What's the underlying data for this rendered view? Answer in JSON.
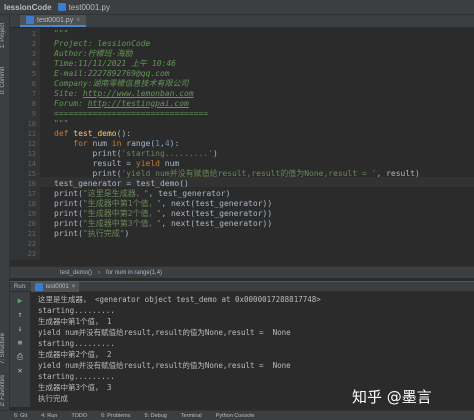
{
  "titlebar": {
    "project": "lessionCode",
    "file": "test0001.py"
  },
  "editor": {
    "tab_label": "test0001.py",
    "line_numbers": [
      "1",
      "2",
      "3",
      "4",
      "5",
      "6",
      "7",
      "8",
      "9",
      "10",
      "11",
      "12",
      "13",
      "14",
      "15",
      "16",
      "17",
      "18",
      "19",
      "20",
      "21",
      "22",
      "23"
    ],
    "lines": [
      {
        "segments": [
          {
            "text": "\"\"\"",
            "cls": "doc"
          }
        ]
      },
      {
        "segments": [
          {
            "text": "Project: lessionCode",
            "cls": "doc"
          }
        ]
      },
      {
        "segments": [
          {
            "text": "Author:柠檬班-海励",
            "cls": "doc"
          }
        ]
      },
      {
        "segments": [
          {
            "text": "Time:11/11/2021 上午 10:46",
            "cls": "doc"
          }
        ]
      },
      {
        "segments": [
          {
            "text": "E-mail:2227892769@qq.com",
            "cls": "doc"
          }
        ]
      },
      {
        "segments": [
          {
            "text": "Company:湖南零檬信息技术有限公司",
            "cls": "doc"
          }
        ]
      },
      {
        "segments": [
          {
            "text": "Site: ",
            "cls": "doc"
          },
          {
            "text": "http://www.lemonban.com",
            "cls": "doc u"
          }
        ]
      },
      {
        "segments": [
          {
            "text": "Forum: ",
            "cls": "doc"
          },
          {
            "text": "http://testingpai.com",
            "cls": "doc u"
          }
        ]
      },
      {
        "segments": [
          {
            "text": "================================",
            "cls": "doc"
          }
        ]
      },
      {
        "segments": [
          {
            "text": "\"\"\"",
            "cls": "doc"
          }
        ]
      },
      {
        "segments": [
          {
            "text": "def ",
            "cls": "kw"
          },
          {
            "text": "test_demo",
            "cls": "fn"
          },
          {
            "text": "():",
            "cls": ""
          }
        ]
      },
      {
        "segments": [
          {
            "text": "    for ",
            "cls": "kw"
          },
          {
            "text": "num ",
            "cls": ""
          },
          {
            "text": "in ",
            "cls": "kw"
          },
          {
            "text": "range(",
            "cls": ""
          },
          {
            "text": "1",
            "cls": "num"
          },
          {
            "text": ",",
            "cls": ""
          },
          {
            "text": "4",
            "cls": "num"
          },
          {
            "text": "):",
            "cls": ""
          }
        ]
      },
      {
        "segments": [
          {
            "text": "        print(",
            "cls": ""
          },
          {
            "text": "'starting.........'",
            "cls": "str"
          },
          {
            "text": ")",
            "cls": ""
          }
        ]
      },
      {
        "segments": [
          {
            "text": "        result = ",
            "cls": ""
          },
          {
            "text": "yield ",
            "cls": "kw"
          },
          {
            "text": "num",
            "cls": ""
          }
        ]
      },
      {
        "segments": [
          {
            "text": "        print(",
            "cls": ""
          },
          {
            "text": "'yield num并没有赋值给result,result的值为None,result = '",
            "cls": "str"
          },
          {
            "text": ", result)",
            "cls": ""
          }
        ]
      },
      {
        "segments": [
          {
            "text": "test_generator = test_demo()",
            "cls": ""
          }
        ]
      },
      {
        "segments": [
          {
            "text": "print(",
            "cls": ""
          },
          {
            "text": "\"这里是生成器，\"",
            "cls": "str"
          },
          {
            "text": ", test_generator)",
            "cls": ""
          }
        ]
      },
      {
        "segments": [
          {
            "text": "print(",
            "cls": ""
          },
          {
            "text": "\"生成器中第1个值，\"",
            "cls": "str"
          },
          {
            "text": ", next(test_generator))",
            "cls": ""
          }
        ]
      },
      {
        "segments": [
          {
            "text": "print(",
            "cls": ""
          },
          {
            "text": "\"生成器中第2个值，\"",
            "cls": "str"
          },
          {
            "text": ", next(test_generator))",
            "cls": ""
          }
        ]
      },
      {
        "segments": [
          {
            "text": "print(",
            "cls": ""
          },
          {
            "text": "\"生成器中第3个值，\"",
            "cls": "str"
          },
          {
            "text": ", next(test_generator))",
            "cls": ""
          }
        ]
      },
      {
        "segments": [
          {
            "text": "print(",
            "cls": ""
          },
          {
            "text": "\"执行完成\"",
            "cls": "str"
          },
          {
            "text": ")",
            "cls": ""
          }
        ]
      }
    ]
  },
  "breadcrumb": {
    "items": [
      "test_demo()",
      "for num in range(1,4)"
    ]
  },
  "run": {
    "label": "Run:",
    "tab": "test0001",
    "output": [
      "这里是生成器， <generator object test_demo at 0x0000017288817748>",
      "starting.........",
      "生成器中第1个值， 1",
      "yield num并没有赋值给result,result的值为None,result =  None",
      "starting.........",
      "生成器中第2个值， 2",
      "yield num并没有赋值给result,result的值为None,result =  None",
      "starting.........",
      "生成器中第3个值， 3",
      "执行完成"
    ]
  },
  "sidebar": {
    "project": "1: Project",
    "commit": "0: Commit",
    "structure": "7: Structure",
    "favorites": "2: Favorites"
  },
  "statusbar": {
    "items": [
      "6: Git",
      "4: Run",
      "TODO",
      "6: Problems",
      "5: Debug",
      "Terminal",
      "Python Console"
    ]
  },
  "watermark": "知乎 @墨言"
}
